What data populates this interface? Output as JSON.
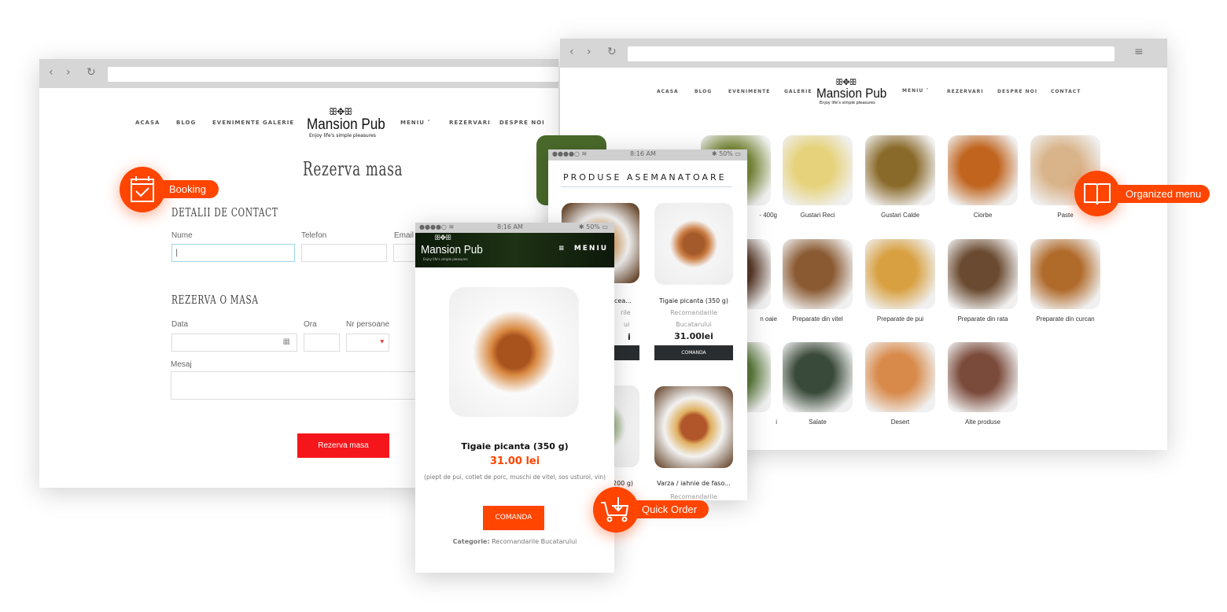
{
  "colors": {
    "accent": "#ff4500",
    "reserve_button": "#f5161b",
    "dark_button": "#2a2d30"
  },
  "brand": {
    "name": "Mansion Pub",
    "tagline": "Enjoy life's simple pleasures",
    "ornament": "ꕥ✥ꕥ"
  },
  "nav": [
    "ACASA",
    "BLOG",
    "EVENIMENTE",
    "GALERIE",
    "MENIU",
    "REZERVARI",
    "DESPRE NOI",
    "CONTACT"
  ],
  "booking_page": {
    "title": "Rezerva masa",
    "section1": "DETALII DE CONTACT",
    "section2": "REZERVA O MASA",
    "labels": {
      "name": "Nume",
      "phone": "Telefon",
      "email": "Email",
      "date": "Data",
      "time": "Ora",
      "persons": "Nr persoane",
      "message": "Mesaj"
    },
    "name_value": "|",
    "submit": "Rezerva masa"
  },
  "menu_page": {
    "categories": [
      {
        "label": "- 400g",
        "color": "#7a8a3a"
      },
      {
        "label": "Gustari Reci",
        "color": "#e6d27a"
      },
      {
        "label": "Gustari Calde",
        "color": "#8a6a2a"
      },
      {
        "label": "Ciorbe",
        "color": "#c0641e"
      },
      {
        "label": "Paste",
        "color": "#d9b48a"
      },
      {
        "label": "n oaie",
        "color": "#5a3a2a"
      },
      {
        "label": "Preparate din vitel",
        "color": "#8a5a32"
      },
      {
        "label": "Preparate de pui",
        "color": "#d8a040"
      },
      {
        "label": "Preparate din rata",
        "color": "#6a4a30"
      },
      {
        "label": "Preparate din curcan",
        "color": "#b06a2a"
      },
      {
        "label": "i",
        "color": "#5a7a3a"
      },
      {
        "label": "Salate",
        "color": "#3a4a3a"
      },
      {
        "label": "Desert",
        "color": "#d88a4a"
      },
      {
        "label": "Alte produse",
        "color": "#7a4a3a"
      }
    ]
  },
  "similar": {
    "title": "PRODUSE ASEMANATOARE",
    "status_time": "8:16 AM",
    "battery": "50%",
    "items": [
      {
        "name": "cu cea...",
        "cat1": "rile",
        "cat2": "ui",
        "price": "i"
      },
      {
        "name": "Tigaie picanta (350 g)",
        "cat1": "Recomandarile",
        "cat2": "Bucatarului",
        "price": "31.00lei"
      },
      {
        "name": "200 g)"
      },
      {
        "name": "Varza / iahnie de faso...",
        "cat1": "Recomandarile"
      }
    ],
    "order_label": "COMANDA"
  },
  "product": {
    "status_time": "8:16 AM",
    "battery": "50%",
    "menu_label": "MENIU",
    "name": "Tigaie picanta (350 g)",
    "price": "31.00 lei",
    "description": "(piept de pui, cotlet de porc, muschi de vitel, sos usturoi, vin)",
    "order": "COMANDA",
    "category_label": "Categorie:",
    "category": "Recomandarile Bucatarului"
  },
  "badges": {
    "booking": "Booking",
    "menu": "Organized menu",
    "order": "Quick Order"
  }
}
